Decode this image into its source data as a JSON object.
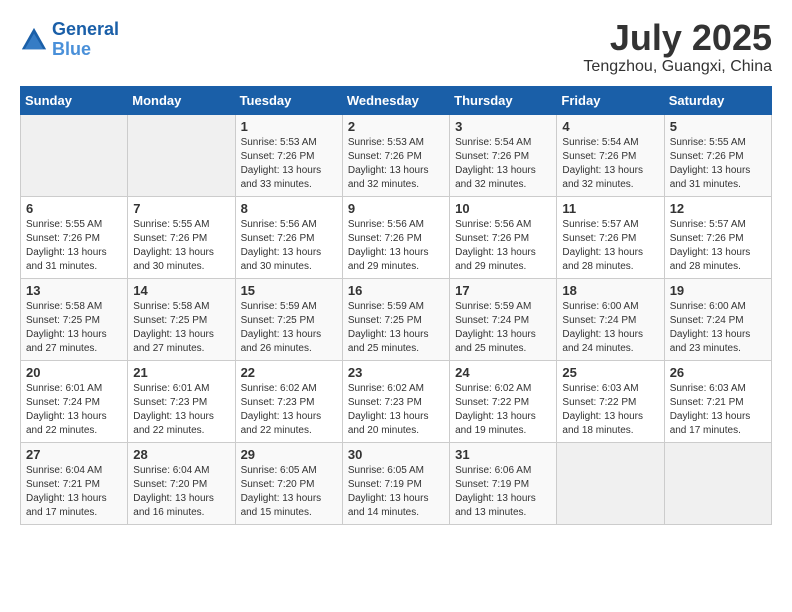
{
  "header": {
    "logo_line1": "General",
    "logo_line2": "Blue",
    "month": "July 2025",
    "location": "Tengzhou, Guangxi, China"
  },
  "weekdays": [
    "Sunday",
    "Monday",
    "Tuesday",
    "Wednesday",
    "Thursday",
    "Friday",
    "Saturday"
  ],
  "weeks": [
    [
      {
        "day": "",
        "detail": ""
      },
      {
        "day": "",
        "detail": ""
      },
      {
        "day": "1",
        "detail": "Sunrise: 5:53 AM\nSunset: 7:26 PM\nDaylight: 13 hours\nand 33 minutes."
      },
      {
        "day": "2",
        "detail": "Sunrise: 5:53 AM\nSunset: 7:26 PM\nDaylight: 13 hours\nand 32 minutes."
      },
      {
        "day": "3",
        "detail": "Sunrise: 5:54 AM\nSunset: 7:26 PM\nDaylight: 13 hours\nand 32 minutes."
      },
      {
        "day": "4",
        "detail": "Sunrise: 5:54 AM\nSunset: 7:26 PM\nDaylight: 13 hours\nand 32 minutes."
      },
      {
        "day": "5",
        "detail": "Sunrise: 5:55 AM\nSunset: 7:26 PM\nDaylight: 13 hours\nand 31 minutes."
      }
    ],
    [
      {
        "day": "6",
        "detail": "Sunrise: 5:55 AM\nSunset: 7:26 PM\nDaylight: 13 hours\nand 31 minutes."
      },
      {
        "day": "7",
        "detail": "Sunrise: 5:55 AM\nSunset: 7:26 PM\nDaylight: 13 hours\nand 30 minutes."
      },
      {
        "day": "8",
        "detail": "Sunrise: 5:56 AM\nSunset: 7:26 PM\nDaylight: 13 hours\nand 30 minutes."
      },
      {
        "day": "9",
        "detail": "Sunrise: 5:56 AM\nSunset: 7:26 PM\nDaylight: 13 hours\nand 29 minutes."
      },
      {
        "day": "10",
        "detail": "Sunrise: 5:56 AM\nSunset: 7:26 PM\nDaylight: 13 hours\nand 29 minutes."
      },
      {
        "day": "11",
        "detail": "Sunrise: 5:57 AM\nSunset: 7:26 PM\nDaylight: 13 hours\nand 28 minutes."
      },
      {
        "day": "12",
        "detail": "Sunrise: 5:57 AM\nSunset: 7:26 PM\nDaylight: 13 hours\nand 28 minutes."
      }
    ],
    [
      {
        "day": "13",
        "detail": "Sunrise: 5:58 AM\nSunset: 7:25 PM\nDaylight: 13 hours\nand 27 minutes."
      },
      {
        "day": "14",
        "detail": "Sunrise: 5:58 AM\nSunset: 7:25 PM\nDaylight: 13 hours\nand 27 minutes."
      },
      {
        "day": "15",
        "detail": "Sunrise: 5:59 AM\nSunset: 7:25 PM\nDaylight: 13 hours\nand 26 minutes."
      },
      {
        "day": "16",
        "detail": "Sunrise: 5:59 AM\nSunset: 7:25 PM\nDaylight: 13 hours\nand 25 minutes."
      },
      {
        "day": "17",
        "detail": "Sunrise: 5:59 AM\nSunset: 7:24 PM\nDaylight: 13 hours\nand 25 minutes."
      },
      {
        "day": "18",
        "detail": "Sunrise: 6:00 AM\nSunset: 7:24 PM\nDaylight: 13 hours\nand 24 minutes."
      },
      {
        "day": "19",
        "detail": "Sunrise: 6:00 AM\nSunset: 7:24 PM\nDaylight: 13 hours\nand 23 minutes."
      }
    ],
    [
      {
        "day": "20",
        "detail": "Sunrise: 6:01 AM\nSunset: 7:24 PM\nDaylight: 13 hours\nand 22 minutes."
      },
      {
        "day": "21",
        "detail": "Sunrise: 6:01 AM\nSunset: 7:23 PM\nDaylight: 13 hours\nand 22 minutes."
      },
      {
        "day": "22",
        "detail": "Sunrise: 6:02 AM\nSunset: 7:23 PM\nDaylight: 13 hours\nand 22 minutes."
      },
      {
        "day": "23",
        "detail": "Sunrise: 6:02 AM\nSunset: 7:23 PM\nDaylight: 13 hours\nand 20 minutes."
      },
      {
        "day": "24",
        "detail": "Sunrise: 6:02 AM\nSunset: 7:22 PM\nDaylight: 13 hours\nand 19 minutes."
      },
      {
        "day": "25",
        "detail": "Sunrise: 6:03 AM\nSunset: 7:22 PM\nDaylight: 13 hours\nand 18 minutes."
      },
      {
        "day": "26",
        "detail": "Sunrise: 6:03 AM\nSunset: 7:21 PM\nDaylight: 13 hours\nand 17 minutes."
      }
    ],
    [
      {
        "day": "27",
        "detail": "Sunrise: 6:04 AM\nSunset: 7:21 PM\nDaylight: 13 hours\nand 17 minutes."
      },
      {
        "day": "28",
        "detail": "Sunrise: 6:04 AM\nSunset: 7:20 PM\nDaylight: 13 hours\nand 16 minutes."
      },
      {
        "day": "29",
        "detail": "Sunrise: 6:05 AM\nSunset: 7:20 PM\nDaylight: 13 hours\nand 15 minutes."
      },
      {
        "day": "30",
        "detail": "Sunrise: 6:05 AM\nSunset: 7:19 PM\nDaylight: 13 hours\nand 14 minutes."
      },
      {
        "day": "31",
        "detail": "Sunrise: 6:06 AM\nSunset: 7:19 PM\nDaylight: 13 hours\nand 13 minutes."
      },
      {
        "day": "",
        "detail": ""
      },
      {
        "day": "",
        "detail": ""
      }
    ]
  ]
}
